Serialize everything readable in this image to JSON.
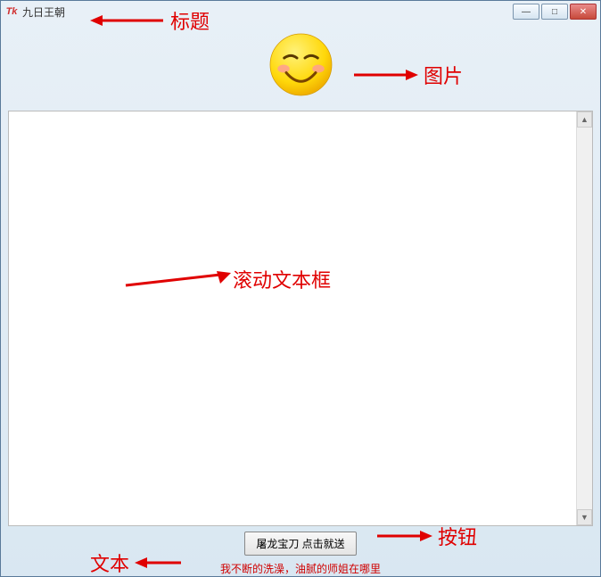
{
  "window": {
    "icon_text": "Tk",
    "title": "九日王朝"
  },
  "controls": {
    "minimize": "—",
    "maximize": "□",
    "close": "✕"
  },
  "emoji": {
    "name": "smiling-face-icon"
  },
  "button": {
    "label": "屠龙宝刀 点击就送"
  },
  "status": {
    "text": "我不断的洗澡，油腻的师姐在哪里"
  },
  "annotations": {
    "title": "标题",
    "image": "图片",
    "textbox": "滚动文本框",
    "button": "按钮",
    "text": "文本"
  }
}
